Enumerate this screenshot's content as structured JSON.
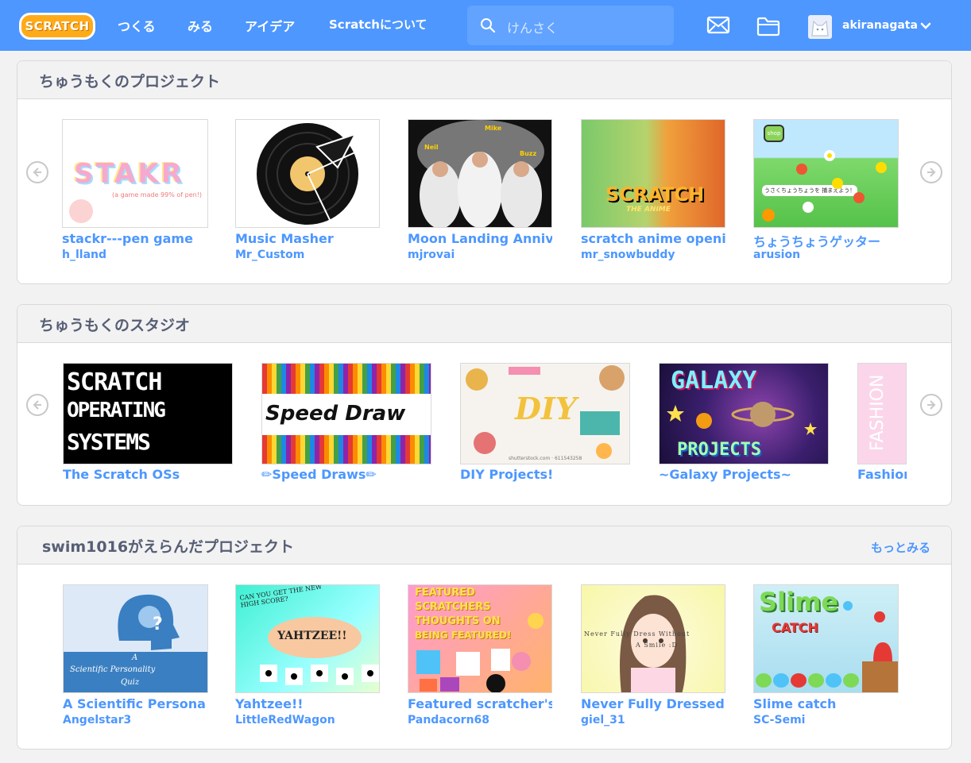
{
  "header": {
    "logo_text": "SCRATCH",
    "nav": [
      "つくる",
      "みる",
      "アイデア",
      "Scratchについて"
    ],
    "search_placeholder": "けんさく",
    "username": "akiranagata"
  },
  "sections": [
    {
      "title": "ちゅうもくのプロジェクト",
      "items": [
        {
          "title": "stackr---pen game",
          "owner": "h_lland",
          "thumb_text": "STAKR",
          "thumb_sub": "(a game made 99% of pen!)"
        },
        {
          "title": "Music Masher",
          "owner": "Mr_Custom"
        },
        {
          "title": "Moon Landing Anniv",
          "owner": "mjrovai",
          "thumb_labels": [
            "Neil",
            "Mike",
            "Buzz"
          ]
        },
        {
          "title": "scratch anime openi",
          "owner": "mr_snowbuddy",
          "thumb_text": "SCRATCH",
          "thumb_sub": "THE ANIME"
        },
        {
          "title": "ちょうちょうゲッター",
          "owner": "arusion",
          "thumb_text": "shop",
          "thumb_sub": "うさくちょうちょうを 捕まえよう！"
        }
      ]
    },
    {
      "title": "ちゅうもくのスタジオ",
      "items": [
        {
          "title": "The Scratch OSs",
          "thumb_lines": [
            "SCRATCH",
            "OPERATING",
            "SYSTEMS"
          ]
        },
        {
          "title": "✏Speed Draws✏",
          "thumb_text": "Speed Draw"
        },
        {
          "title": "DIY Projects!",
          "thumb_text": "DIY",
          "thumb_sub": "shutterstock.com · 611543258"
        },
        {
          "title": "~Galaxy Projects~",
          "thumb_lines": [
            "GALAXY",
            "PROJECTS"
          ]
        },
        {
          "title": "Fashion",
          "thumb_text": "FASHION"
        }
      ]
    },
    {
      "title": "swim1016がえらんだプロジェクト",
      "more": "もっとみる",
      "items": [
        {
          "title": "A Scientific Persona",
          "owner": "Angelstar3",
          "thumb_lines": [
            "A",
            "Scientific Personality",
            "Quiz"
          ]
        },
        {
          "title": "Yahtzee!!",
          "owner": "LittleRedWagon",
          "thumb_text": "YAHTZEE!!",
          "thumb_sub": "CAN YOU GET THE NEW HIGH SCORE?"
        },
        {
          "title": "Featured scratcher's",
          "owner": "Pandacorn68",
          "thumb_lines": [
            "FEATURED",
            "SCRATCHERS",
            "THOUGHTS ON",
            "BEING FEATURED!"
          ]
        },
        {
          "title": "Never Fully Dressed",
          "owner": "giel_31",
          "thumb_text": "Never Fully Dress Without",
          "thumb_sub": "A Smile :D"
        },
        {
          "title": "Slime catch",
          "owner": "SC-Semi",
          "thumb_text": "Slime",
          "thumb_sub": "CATCH"
        }
      ]
    }
  ],
  "colors": {
    "header_bg": "#4d97ff",
    "link": "#4d97ff",
    "heading": "#575e75",
    "page_bg": "#f2f2f2"
  }
}
